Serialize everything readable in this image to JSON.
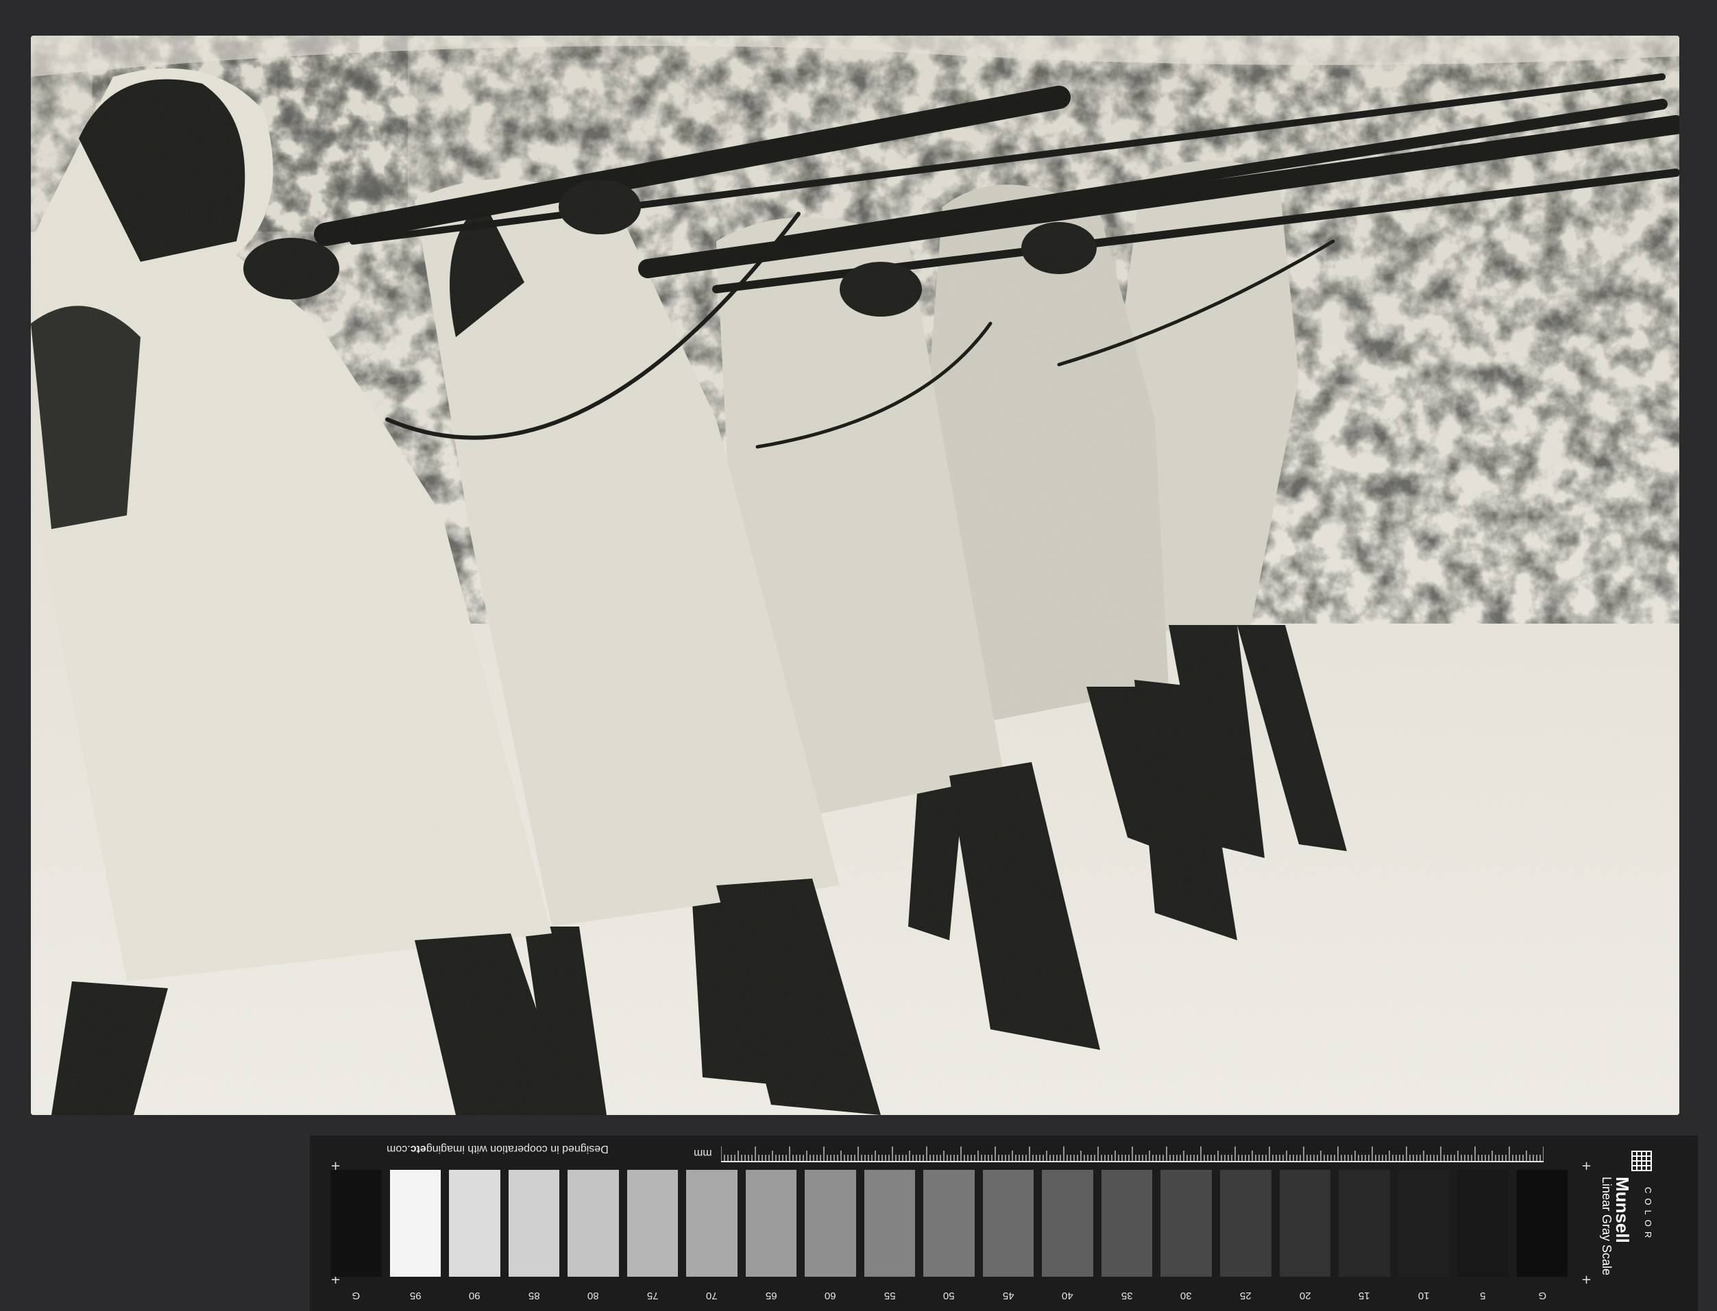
{
  "photo": {
    "description_label": "Archival black and white photograph",
    "colors": {
      "paper": "#e8e5da",
      "dark": "#1a1a17",
      "mid": "#8f8c82",
      "light": "#f2f0e8"
    }
  },
  "target": {
    "ruler_unit": "mm",
    "credit_prefix": "Designed in cooperation with imaging",
    "credit_bold": "etc",
    "credit_suffix": ".com",
    "brand_name": "Munsell",
    "brand_sub": "COLOR",
    "brand_scale": "Linear Gray Scale",
    "brand_logo_icon": "munsell-grid-icon",
    "patch_labels": [
      "G",
      "95",
      "90",
      "85",
      "80",
      "75",
      "70",
      "65",
      "60",
      "55",
      "50",
      "45",
      "40",
      "35",
      "30",
      "25",
      "20",
      "15",
      "10",
      "5",
      "G"
    ],
    "patch_colors": [
      "#111111",
      "#f4f4f4",
      "#dcdcdc",
      "#d0d0d0",
      "#c4c4c4",
      "#b6b6b6",
      "#a9a9a9",
      "#9c9c9c",
      "#8f8f8f",
      "#838383",
      "#777777",
      "#6b6b6b",
      "#5f5f5f",
      "#545454",
      "#484848",
      "#3d3d3d",
      "#333333",
      "#292929",
      "#202020",
      "#181818",
      "#0e0e0e"
    ],
    "cross_glyph": "+"
  }
}
